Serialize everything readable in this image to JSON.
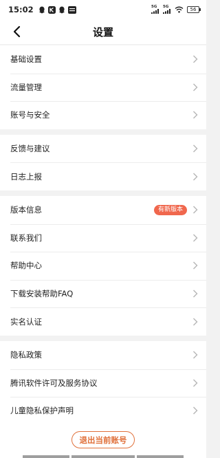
{
  "status_bar": {
    "time": "15:02",
    "signal1": "5G",
    "signal2": "5G",
    "battery": "56"
  },
  "nav": {
    "title": "设置"
  },
  "groups": [
    {
      "items": [
        {
          "label": "基础设置"
        },
        {
          "label": "流量管理"
        },
        {
          "label": "账号与安全"
        }
      ]
    },
    {
      "items": [
        {
          "label": "反馈与建议"
        },
        {
          "label": "日志上报"
        }
      ]
    },
    {
      "items": [
        {
          "label": "版本信息",
          "badge": "有新版本"
        },
        {
          "label": "联系我们"
        },
        {
          "label": "帮助中心"
        },
        {
          "label": "下载安装帮助FAQ"
        },
        {
          "label": "实名认证"
        }
      ]
    },
    {
      "items": [
        {
          "label": "隐私政策"
        },
        {
          "label": "腾讯软件许可及服务协议"
        },
        {
          "label": "儿童隐私保护声明"
        }
      ]
    }
  ],
  "logout": {
    "label": "退出当前账号"
  },
  "colors": {
    "accent": "#e0703a",
    "badge": "#f0674d"
  }
}
